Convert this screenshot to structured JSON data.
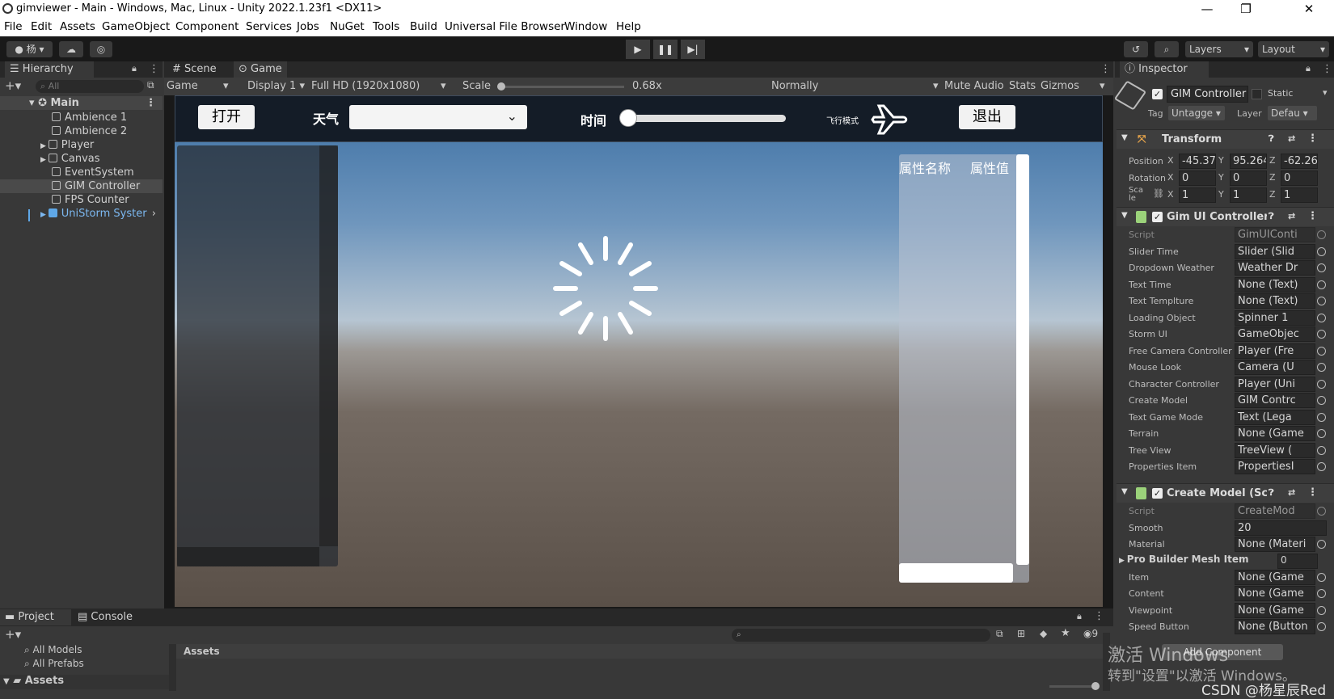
{
  "window": {
    "title": "gimviewer - Main - Windows, Mac, Linux - Unity 2022.1.23f1 <DX11>",
    "minimize": "—",
    "maximize": "❐",
    "close": "✕"
  },
  "menu": [
    "File",
    "Edit",
    "Assets",
    "GameObject",
    "Component",
    "Services",
    "Jobs",
    "NuGet",
    "Tools",
    "Build",
    "Universal File Browser",
    "Window",
    "Help"
  ],
  "toolbar": {
    "account": "杨",
    "play": "▶",
    "pause": "❚❚",
    "step": "▶|",
    "layers": "Layers",
    "layout": "Layout"
  },
  "hierarchy": {
    "tab": "Hierarchy",
    "search_placeholder": "All",
    "scene": "Main",
    "items": [
      "Ambience 1",
      "Ambience 2",
      "Player",
      "Canvas",
      "EventSystem",
      "GIM Controller",
      "FPS Counter",
      "UniStorm Syster"
    ]
  },
  "game": {
    "tabs": [
      "Scene",
      "Game"
    ],
    "bar": {
      "mode": "Game",
      "display": "Display 1",
      "resolution": "Full HD (1920x1080)",
      "scale_label": "Scale",
      "scale_value": "0.68x",
      "normally": "Normally",
      "mute": "Mute Audio",
      "stats": "Stats",
      "gizmos": "Gizmos"
    },
    "ui": {
      "open": "打开",
      "weather": "天气",
      "time": "时间",
      "fly": "飞行模式",
      "exit": "退出",
      "prop_name": "属性名称",
      "prop_value": "属性值"
    }
  },
  "inspector": {
    "tab": "Inspector",
    "object_name": "GIM Controller",
    "static": "Static",
    "tag_label": "Tag",
    "tag": "Untagge",
    "layer_label": "Layer",
    "layer": "Defau",
    "transform": {
      "title": "Transform",
      "position": {
        "label": "Position",
        "x": "-45.37",
        "y": "95.264",
        "z": "-62.26"
      },
      "rotation": {
        "label": "Rotation",
        "x": "0",
        "y": "0",
        "z": "0"
      },
      "scale": {
        "label": "Sca le",
        "x": "1",
        "y": "1",
        "z": "1"
      }
    },
    "gim_ui": {
      "title": "Gim UI Controller (Sc",
      "rows": [
        {
          "label": "Script",
          "value": "GimUIConti"
        },
        {
          "label": "Slider Time",
          "value": "Slider (Slid"
        },
        {
          "label": "Dropdown Weather",
          "value": "Weather Dr"
        },
        {
          "label": "Text Time",
          "value": "None (Text)"
        },
        {
          "label": "Text Templture",
          "value": "None (Text)"
        },
        {
          "label": "Loading Object",
          "value": "Spinner 1"
        },
        {
          "label": "Storm UI",
          "value": "GameObjec"
        },
        {
          "label": "Free Camera Controller",
          "value": "Player (Fre"
        },
        {
          "label": "Mouse Look",
          "value": "Camera (U"
        },
        {
          "label": "Character Controller",
          "value": "Player (Uni"
        },
        {
          "label": "Create Model",
          "value": "GIM Contrc"
        },
        {
          "label": "Text Game Mode",
          "value": "Text (Lega"
        },
        {
          "label": "Terrain",
          "value": "None (Game"
        },
        {
          "label": "Tree View",
          "value": "TreeView ("
        },
        {
          "label": "Properties Item",
          "value": "PropertiesI"
        }
      ]
    },
    "create_model": {
      "title": "Create Model (Scrip",
      "rows": [
        {
          "label": "Script",
          "value": "CreateMod"
        },
        {
          "label": "Smooth",
          "value": "20"
        },
        {
          "label": "Material",
          "value": "None (Materi"
        }
      ],
      "pro_builder": "Pro Builder Mesh Item",
      "pro_builder_value": "0",
      "rows2": [
        {
          "label": "Item",
          "value": "None (Game"
        },
        {
          "label": "Content",
          "value": "None (Game"
        },
        {
          "label": "Viewpoint",
          "value": "None (Game"
        },
        {
          "label": "Speed Button",
          "value": "None (Button"
        }
      ],
      "add_component": "Add Component"
    }
  },
  "bottom": {
    "tabs": [
      "Project",
      "Console"
    ],
    "favorites": [
      "All Models",
      "All Prefabs"
    ],
    "assets_header": "Assets",
    "assets_folder": "Assets",
    "hidden_count": "9"
  },
  "watermark": {
    "line1": "激活 Windows",
    "line2": "转到\"设置\"以激活 Windows。",
    "csdn": "CSDN @杨星辰Red"
  }
}
